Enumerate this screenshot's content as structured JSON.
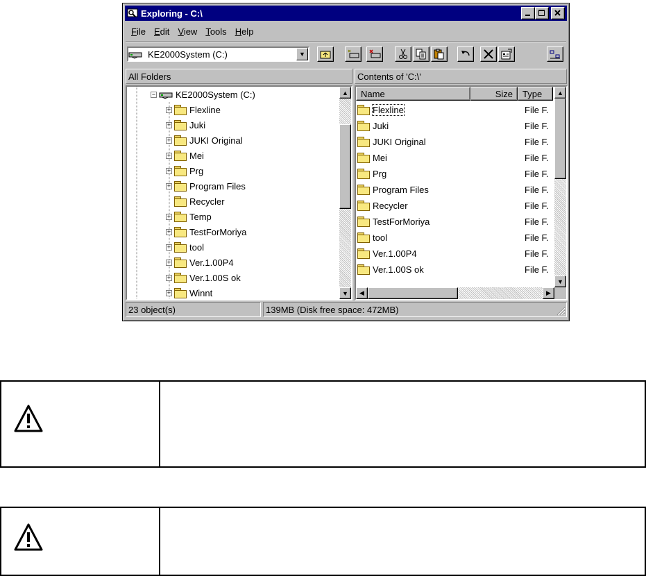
{
  "window": {
    "title": "Exploring - C:\\",
    "buttons": {
      "minimize": "_",
      "maximize": "□",
      "close": "✕"
    }
  },
  "menu": [
    "File",
    "Edit",
    "View",
    "Tools",
    "Help"
  ],
  "menu_access_keys": [
    "F",
    "E",
    "V",
    "T",
    "H"
  ],
  "toolbar": {
    "drive_value": "KE2000System (C:)"
  },
  "panes": {
    "left_header": "All Folders",
    "right_header": "Contents of 'C:\\'"
  },
  "tree": {
    "root": "KE2000System (C:)",
    "items": [
      {
        "label": "Flexline",
        "expandable": true
      },
      {
        "label": "Juki",
        "expandable": true
      },
      {
        "label": "JUKI Original",
        "expandable": true
      },
      {
        "label": "Mei",
        "expandable": true
      },
      {
        "label": "Prg",
        "expandable": true
      },
      {
        "label": "Program Files",
        "expandable": true
      },
      {
        "label": "Recycler",
        "expandable": false
      },
      {
        "label": "Temp",
        "expandable": true
      },
      {
        "label": "TestForMoriya",
        "expandable": true
      },
      {
        "label": "tool",
        "expandable": true
      },
      {
        "label": "Ver.1.00P4",
        "expandable": true
      },
      {
        "label": "Ver.1.00S ok",
        "expandable": true
      },
      {
        "label": "Winnt",
        "expandable": true
      }
    ]
  },
  "list": {
    "columns": [
      "Name",
      "Size",
      "Type"
    ],
    "rows": [
      {
        "name": "Flexline",
        "type": "File F."
      },
      {
        "name": "Juki",
        "type": "File F."
      },
      {
        "name": "JUKI Original",
        "type": "File F."
      },
      {
        "name": "Mei",
        "type": "File F."
      },
      {
        "name": "Prg",
        "type": "File F."
      },
      {
        "name": "Program Files",
        "type": "File F."
      },
      {
        "name": "Recycler",
        "type": "File F."
      },
      {
        "name": "TestForMoriya",
        "type": "File F."
      },
      {
        "name": "tool",
        "type": "File F."
      },
      {
        "name": "Ver.1.00P4",
        "type": "File F."
      },
      {
        "name": "Ver.1.00S ok",
        "type": "File F."
      }
    ]
  },
  "status": {
    "objects": "23 object(s)",
    "disk": "139MB (Disk free space: 472MB)"
  },
  "colors": {
    "titlebar": "#000080",
    "face": "#c0c0c0"
  }
}
